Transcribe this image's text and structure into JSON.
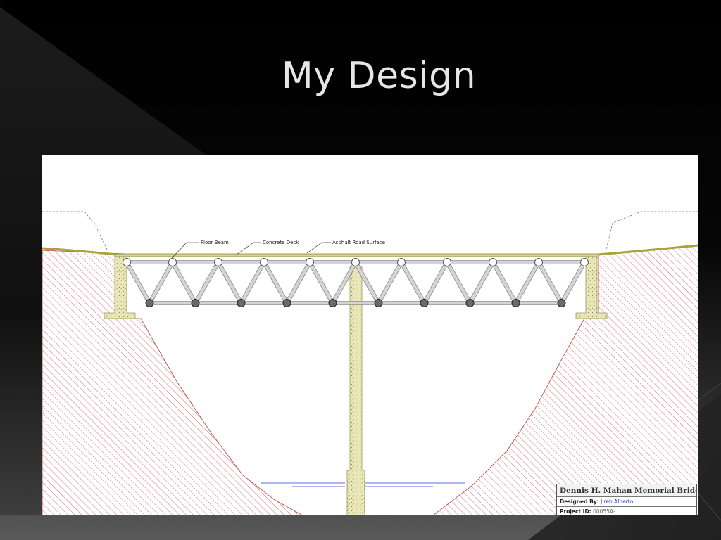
{
  "slide": {
    "title": "My Design"
  },
  "drawing": {
    "callouts": {
      "floor_beam": "Floor Beam",
      "concrete_deck": "Concrete Deck",
      "asphalt_road_surface": "Asphalt Road Surface"
    },
    "title_block": {
      "bridge_name": "Dennis H. Mahan Memorial Bridge",
      "designed_by_label": "Designed By:",
      "designed_by_value": "Jireh Alberto",
      "project_id_label": "Project ID:",
      "project_id_value": "00055A-"
    }
  },
  "colors": {
    "background": "#000000",
    "title_text": "#e6e6e6",
    "soil_hatch": "#c0393b",
    "concrete": "#e8e6b0",
    "concrete_outline": "#9a9a55",
    "truss_member": "#c8c8c8",
    "joint_bottom": "#6a6a6a",
    "water_line": "#2a3bd9",
    "designer_name": "#1f3fc7"
  }
}
